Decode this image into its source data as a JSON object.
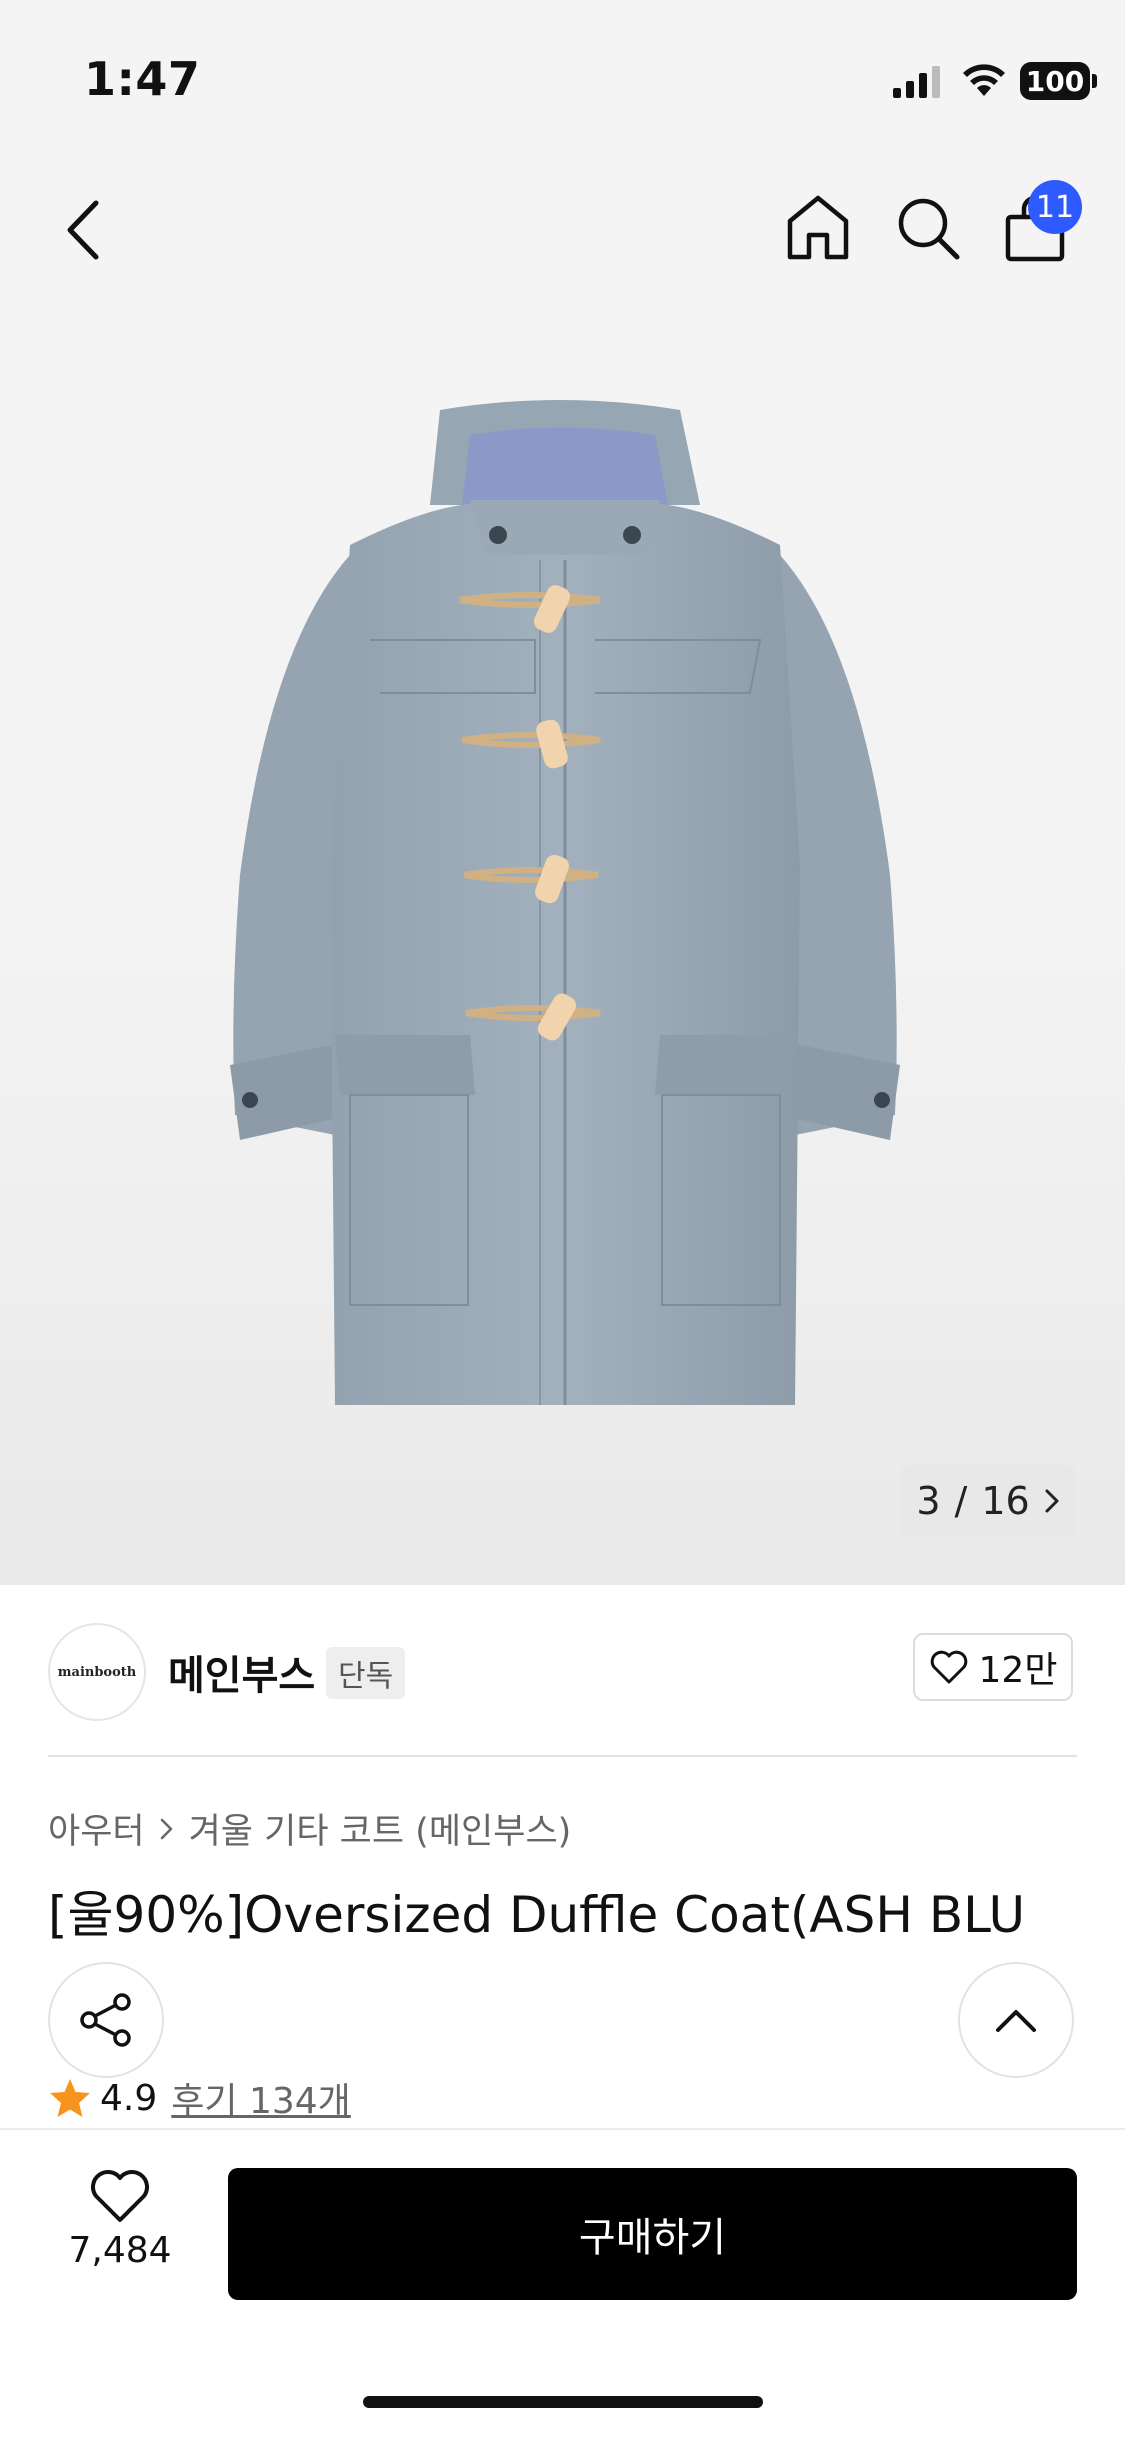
{
  "status_bar": {
    "time": "1:47",
    "battery": "100"
  },
  "header": {
    "cart_badge": "11"
  },
  "gallery": {
    "current": "3",
    "separator": "/",
    "total": "16"
  },
  "brand": {
    "logo_text": "mainbooth",
    "name": "메인부스",
    "tag": "단독",
    "likes": "12만"
  },
  "breadcrumb": {
    "level1": "아우터",
    "level2": "겨울 기타 코트 (메인부스)"
  },
  "product": {
    "title": "[울90%]Oversized Duffle Coat(ASH BLU",
    "rating": "4.9",
    "reviews": "후기 134개"
  },
  "bottom": {
    "wish_count": "7,484",
    "buy_label": "구매하기"
  },
  "colors": {
    "accent_badge": "#2d5bff",
    "star": "#f7941d",
    "coat": "#9aa9b5",
    "toggle": "#f1d3ae",
    "rope": "#d1b184"
  }
}
